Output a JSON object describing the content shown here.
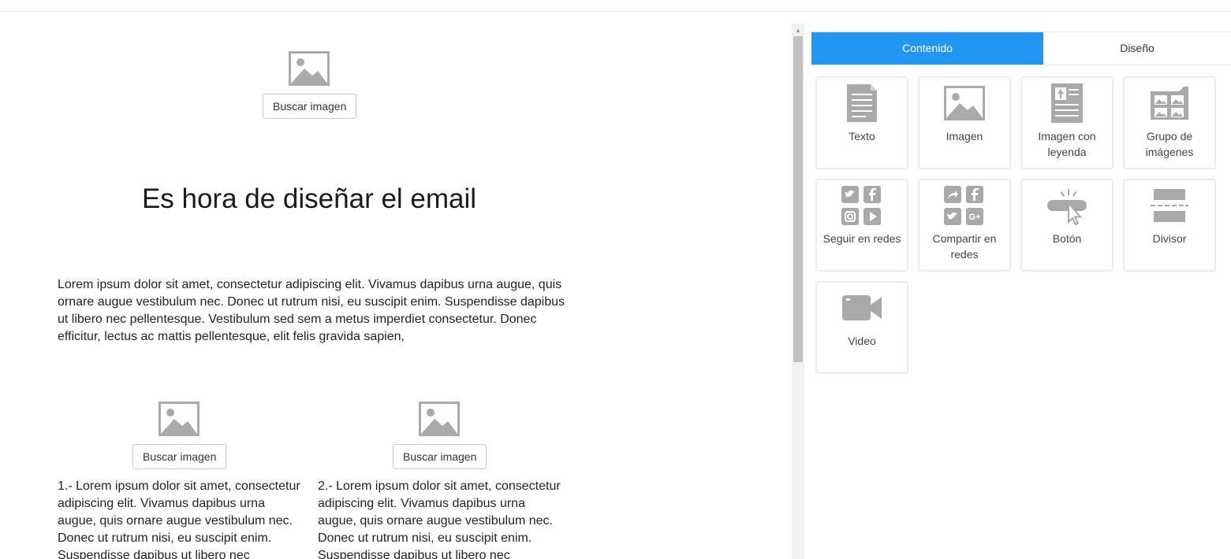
{
  "canvas": {
    "top_image_button": "Buscar imagen",
    "headline": "Es hora de diseñar el email",
    "body_text": "Lorem ipsum dolor sit amet, consectetur adipiscing elit. Vivamus dapibus urna augue, quis ornare augue vestibulum nec. Donec ut rutrum nisi, eu suscipit enim. Suspendisse dapibus ut libero nec pellentesque. Vestibulum sed sem a metus imperdiet consectetur. Donec efficitur, lectus ac mattis pellentesque, elit felis gravida sapien,",
    "columns": [
      {
        "image_button": "Buscar imagen",
        "text": "1.- Lorem ipsum dolor sit amet, consectetur adipiscing elit. Vivamus dapibus urna augue, quis ornare augue vestibulum nec. Donec ut rutrum nisi, eu suscipit enim. Suspendisse dapibus ut libero nec"
      },
      {
        "image_button": "Buscar imagen",
        "text": "2.- Lorem ipsum dolor sit amet, consectetur adipiscing elit. Vivamus dapibus urna augue, quis ornare augue vestibulum nec. Donec ut rutrum nisi, eu suscipit enim. Suspendisse dapibus ut libero nec"
      }
    ]
  },
  "panel": {
    "tabs": [
      {
        "label": "Contenido",
        "active": true
      },
      {
        "label": "Diseño",
        "active": false
      }
    ],
    "blocks": [
      {
        "label": "Texto",
        "icon": "text-document-icon"
      },
      {
        "label": "Imagen",
        "icon": "image-icon"
      },
      {
        "label": "Imagen con leyenda",
        "icon": "image-with-caption-icon"
      },
      {
        "label": "Grupo de imágenes",
        "icon": "image-group-icon"
      },
      {
        "label": "Seguir en redes",
        "icon": "social-follow-icon"
      },
      {
        "label": "Compartir en redes",
        "icon": "social-share-icon"
      },
      {
        "label": "Botón",
        "icon": "button-click-icon"
      },
      {
        "label": "Divisor",
        "icon": "divider-icon"
      },
      {
        "label": "Video",
        "icon": "video-camera-icon"
      }
    ]
  },
  "colors": {
    "accent": "#2196f3",
    "icon_gray": "#a9a9a9",
    "tile_border": "#ececec"
  }
}
